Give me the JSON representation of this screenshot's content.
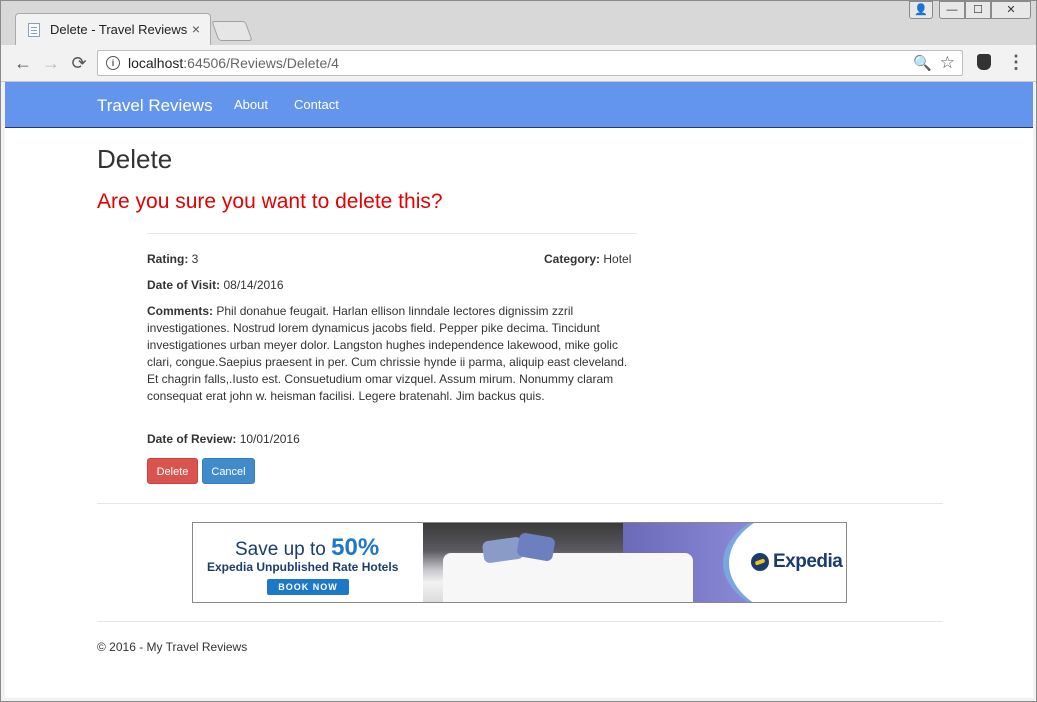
{
  "browser": {
    "tab_title": "Delete - Travel Reviews",
    "tab_close": "×",
    "url_host": "localhost",
    "url_rest": ":64506/Reviews/Delete/4",
    "window_controls": {
      "user": "👤",
      "minimize": "—",
      "maximize": "☐",
      "close": "✕"
    },
    "nav_icons": {
      "back": "←",
      "forward": "→",
      "reload": "⟳",
      "zoom": "🔍",
      "star": "☆",
      "menu": "⋮",
      "info": "i"
    }
  },
  "navbar": {
    "brand": "Travel Reviews",
    "links": [
      "About",
      "Contact"
    ],
    "color": "#6495ed"
  },
  "page": {
    "title": "Delete",
    "warning": "Are you sure you want to delete this?",
    "warning_color": "#e60000"
  },
  "review": {
    "rating_label": "Rating:",
    "rating_value": "3",
    "category_label": "Category:",
    "category_value": "Hotel",
    "visit_label": "Date of Visit:",
    "visit_value": "08/14/2016",
    "comments_label": "Comments:",
    "comments_value": "Phil donahue feugait. Harlan ellison linndale lectores dignissim zzril investigationes. Nostrud lorem dynamicus jacobs field. Pepper pike decima. Tincidunt investigationes urban meyer dolor. Langston hughes independence lakewood, mike golic clari, congue.Saepius praesent in per. Cum chrissie hynde ii parma, aliquip east cleveland. Et chagrin falls,.Iusto est. Consuetudium omar vizquel. Assum mirum. Nonummy claram consequat erat john w. heisman facilisi. Legere bratenahl. Jim backus quis.",
    "review_label": "Date of Review:",
    "review_value": "10/01/2016"
  },
  "buttons": {
    "delete": "Delete",
    "cancel": "Cancel"
  },
  "banner": {
    "save_prefix": "Save up to ",
    "save_pct": "50%",
    "subtitle": "Expedia Unpublished Rate Hotels",
    "cta": "BOOK NOW",
    "logo": "Expedia"
  },
  "footer": {
    "text": "© 2016 - My Travel Reviews"
  }
}
